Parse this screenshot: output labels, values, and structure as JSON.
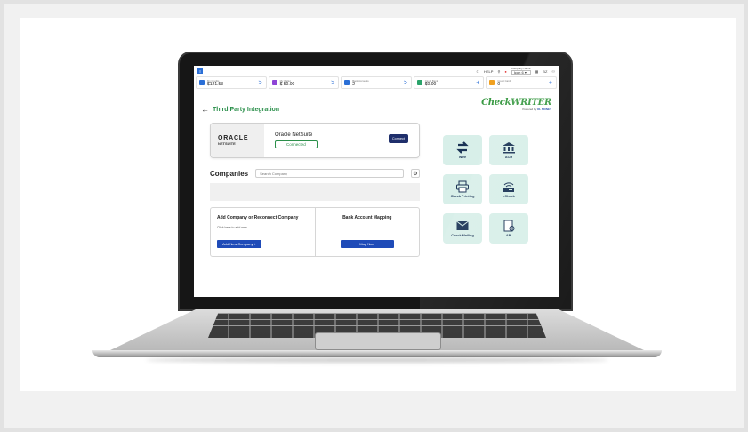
{
  "topbar": {
    "help_label": "HELP",
    "company_context_label": "Company Name",
    "company_selected": "Icon 6 ▾",
    "user_initials": "BZ"
  },
  "stats": [
    {
      "label": "My Credits",
      "value": "$121.53",
      "color": "#2b6fd6",
      "action": ">"
    },
    {
      "label": "My Wallet",
      "value": "$ 50.00",
      "color": "#8e44d6",
      "action": ">"
    },
    {
      "label": "Bank Accounts",
      "value": "2",
      "color": "#2b6fd6",
      "action": ">"
    },
    {
      "label": "Cloud Bank",
      "value": "$0.00",
      "color": "#2aa36a",
      "action": "+"
    },
    {
      "label": "Credit Cards",
      "value": "0",
      "color": "#f0a020",
      "action": "+"
    }
  ],
  "page": {
    "title": "Third Party Integration"
  },
  "brand": {
    "name": "CheckWRITER",
    "powered_by": "Powered by",
    "partner": "OL MONEY"
  },
  "integration": {
    "logo_top": "ORACLE",
    "logo_bottom": "NETSUITE",
    "name": "Oracle NetSuite",
    "status": "Connected",
    "connect_label": "Connect"
  },
  "companies": {
    "title": "Companies",
    "search_placeholder": "Search Company"
  },
  "add_company": {
    "title": "Add Company or Reconnect Company",
    "subtitle": "Click here to add new",
    "button_label": "Add New Company ↓"
  },
  "mapping": {
    "title": "Bank Account Mapping",
    "button_label": "Map Now"
  },
  "tiles": [
    {
      "label": "Wire",
      "icon": "transfer-arrows-icon"
    },
    {
      "label": "ACH",
      "icon": "bank-icon"
    },
    {
      "label": "Check Printing",
      "icon": "printer-icon"
    },
    {
      "label": "eCheck",
      "icon": "echeck-icon"
    },
    {
      "label": "Check Mailing",
      "icon": "envelope-icon"
    },
    {
      "label": "API",
      "icon": "api-document-icon"
    }
  ],
  "colors": {
    "accent_green": "#2a8f4a",
    "tile_bg": "#d8efe9",
    "primary_blue": "#1f4bb8",
    "connect_navy": "#1f2f6b"
  }
}
